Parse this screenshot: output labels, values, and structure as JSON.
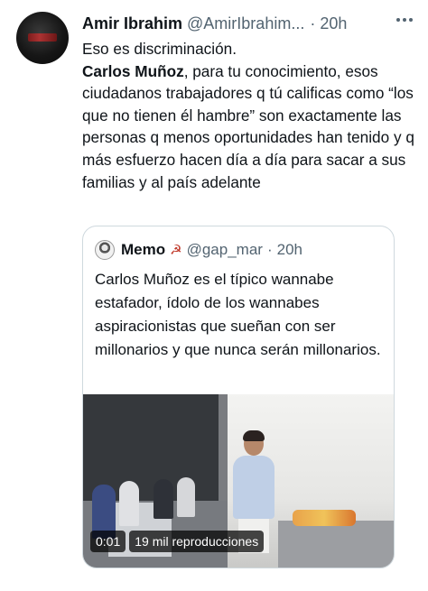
{
  "tweet": {
    "author_name": "Amir Ibrahim",
    "author_handle": "@AmirIbrahim...",
    "dot": "·",
    "time": "20h",
    "line1": "Eso es discriminación.",
    "mention": "Carlos Muñoz",
    "body_rest": ", para tu conocimiento, esos ciudadanos trabajadores q tú calificas como “los que no tienen él hambre” son exactamente las personas q menos oportunidades han tenido y q más esfuerzo hacen día a día para sacar a sus familias y al país adelante"
  },
  "quote": {
    "author_name": "Memo",
    "symbol": "☭",
    "author_handle": "@gap_mar",
    "dot": "·",
    "time": "20h",
    "text": "Carlos Muñoz es el típico wannabe estafador, ídolo de los wannabes aspiracionistas que sueñan con ser millonarios y que nunca serán millonarios.",
    "video": {
      "duration": "0:01",
      "views": "19 mil reproducciones"
    }
  },
  "icons": {
    "more": "more-icon"
  }
}
